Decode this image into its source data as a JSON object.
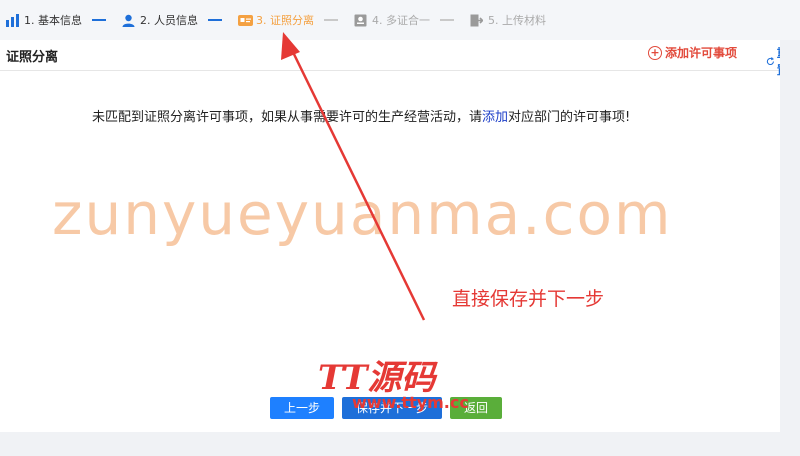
{
  "steps": [
    {
      "label": "1. 基本信息",
      "state": "done",
      "icon": "chart-icon"
    },
    {
      "label": "2. 人员信息",
      "state": "done",
      "icon": "person-icon"
    },
    {
      "label": "3. 证照分离",
      "state": "active",
      "icon": "card-icon"
    },
    {
      "label": "4. 多证合一",
      "state": "todo",
      "icon": "badge-icon"
    },
    {
      "label": "5. 上传材料",
      "state": "todo",
      "icon": "upload-icon"
    }
  ],
  "panel": {
    "title": "证照分离",
    "add_label": "添加许可事项",
    "reset_label": "重置",
    "message_prefix": "未匹配到证照分离许可事项，如果从事需要许可的生产经营活动，请",
    "message_link": "添加",
    "message_suffix": "对应部门的许可事项!"
  },
  "buttons": {
    "prev": "上一步",
    "save_next": "保存并下一步",
    "back": "返回"
  },
  "overlay": {
    "watermark": "zunyueyuanma.com",
    "annotation": "直接保存并下一步",
    "logo": "TT源码",
    "logo_url": "www.ttym.cc"
  },
  "colors": {
    "primary": "#1e6fd9",
    "active_step": "#f4a142",
    "danger": "#e24a3b",
    "success": "#5aae3a"
  }
}
